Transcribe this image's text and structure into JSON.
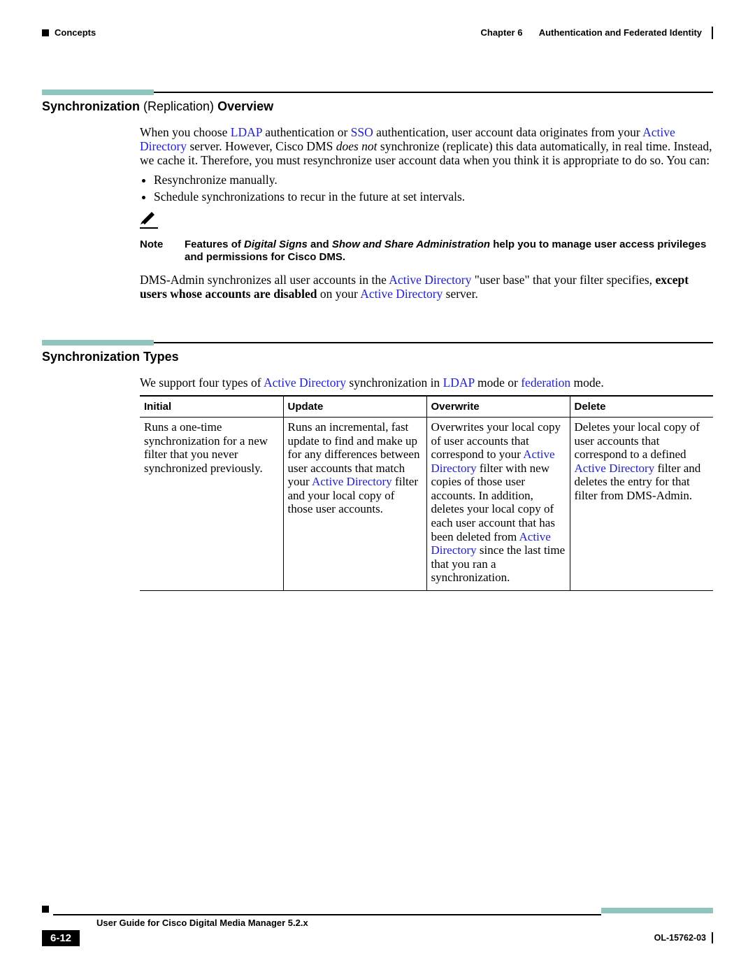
{
  "header": {
    "section_left": "Concepts",
    "chapter_label": "Chapter 6",
    "chapter_title": "Authentication and Federated Identity"
  },
  "sec1": {
    "h_bold1": "Synchronization ",
    "h_light": "(Replication)",
    "h_bold2": " Overview",
    "p1_a": "When you choose ",
    "p1_ldap": "LDAP",
    "p1_b": " authentication or ",
    "p1_sso": "SSO",
    "p1_c": " authentication, user account data originates from your ",
    "p1_ad": "Active Directory",
    "p1_d": " server. However, Cisco DMS ",
    "p1_doesnot": "does not",
    "p1_e": " synchronize (replicate) this data automatically, in real time. Instead, we cache it. Therefore, you must resynchronize user account data when you think it is appropriate to do so. You can:",
    "bul1": "Resynchronize manually.",
    "bul2": "Schedule synchronizations to recur in the future at set intervals.",
    "note_label": "Note",
    "note_a": "Features of ",
    "note_ds": "Digital Signs",
    "note_b": " and ",
    "note_ssa": "Show and Share Administration",
    "note_c": " help you to manage user access privileges and permissions for Cisco DMS.",
    "p2_a": "DMS-Admin synchronizes all user accounts in the ",
    "p2_ad": "Active Directory",
    "p2_b": " \"user base\" that your filter specifies, ",
    "p2_bold": "except users whose accounts are disabled",
    "p2_c": " on your ",
    "p2_ad2": "Active Directory",
    "p2_d": " server."
  },
  "sec2": {
    "h": "Synchronization Types",
    "intro_a": "We support four types of ",
    "intro_ad": "Active Directory",
    "intro_b": " synchronization in ",
    "intro_ldap": "LDAP",
    "intro_c": " mode or ",
    "intro_fed": "federation",
    "intro_d": " mode.",
    "th": {
      "c1": "Initial",
      "c2": "Update",
      "c3": "Overwrite",
      "c4": "Delete"
    },
    "c1": "Runs a one-time synchronization for a new filter that you never synchronized previously.",
    "c2_a": "Runs an incremental, fast update to find and make up for any differences between user accounts that match your ",
    "c2_ad": "Active Directory",
    "c2_b": " filter and your local copy of those user accounts.",
    "c3_a": "Overwrites your local copy of user accounts that correspond to your ",
    "c3_ad": "Active Directory",
    "c3_b": " filter with new copies of those user accounts. In addition, deletes your local copy of each user account that has been deleted from ",
    "c3_ad2": "Active Directory",
    "c3_c": " since the last time that you ran a synchronization.",
    "c4_a": "Deletes your local copy of user accounts that correspond to a defined ",
    "c4_ad": "Active Directory",
    "c4_b": " filter and deletes the entry for that filter from DMS-Admin."
  },
  "footer": {
    "guide": "User Guide for Cisco Digital Media Manager 5.2.x",
    "page": "6-12",
    "docid": "OL-15762-03"
  }
}
